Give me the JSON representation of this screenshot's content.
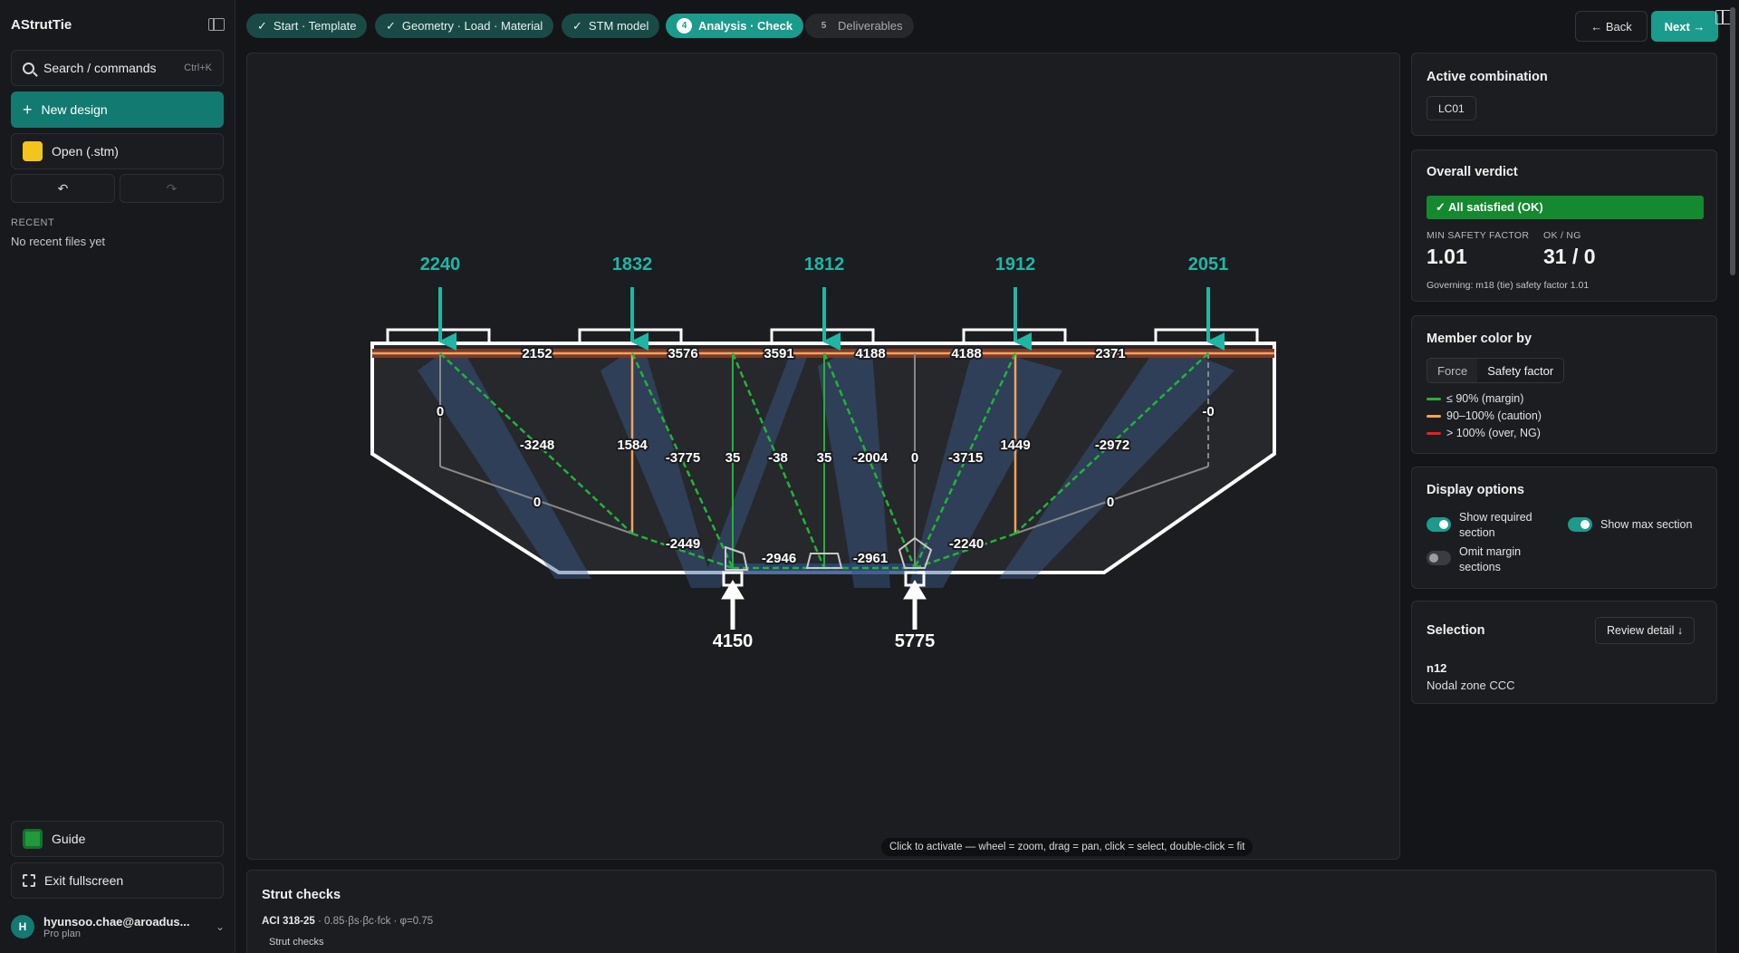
{
  "sidebar": {
    "brand": "AStrutTie",
    "search_label": "Search / commands",
    "search_shortcut": "Ctrl+K",
    "new_design_label": "New design",
    "open_label": "Open (.stm)",
    "recent_label": "RECENT",
    "recent_empty": "No recent files yet",
    "guide_label": "Guide",
    "fullscreen_label": "Exit fullscreen",
    "user_name": "hyunsoo.chae@aroadus...",
    "user_plan": "Pro plan",
    "user_initial": "H"
  },
  "stepper": [
    {
      "label": "Start · Template",
      "mark": "✓",
      "state": "done"
    },
    {
      "label": "Geometry · Load · Material",
      "mark": "✓",
      "state": "done"
    },
    {
      "label": "STM model",
      "mark": "✓",
      "state": "done"
    },
    {
      "label": "Analysis · Check",
      "mark": "4",
      "state": "active"
    },
    {
      "label": "Deliverables",
      "mark": "5",
      "state": "future"
    }
  ],
  "nav": {
    "back_label": "← Back",
    "next_label": "Next →"
  },
  "canvas": {
    "hint": "Click to activate — wheel = zoom, drag = pan, click = select, double-click = fit",
    "loads": [
      "2240",
      "1832",
      "1812",
      "1912",
      "2051"
    ],
    "reactions": [
      "4150",
      "5775"
    ],
    "top_chord_forces": [
      "2152",
      "3576",
      "3591",
      "4188",
      "4188",
      "2371"
    ],
    "member_forces": [
      "0",
      "-3248",
      "1584",
      "-3775",
      "35",
      "-38",
      "35",
      "-2004",
      "0",
      "-3715",
      "1449",
      "-2972",
      "-0"
    ],
    "bottom_forces": [
      "0",
      "-2449",
      "-2946",
      "-2961",
      "-2240",
      "0"
    ]
  },
  "checks": {
    "title": "Strut checks",
    "code": "ACI 318-25",
    "formula": "· 0.85·βs·βc·fck · φ=0.75",
    "tab": "Strut checks"
  },
  "panel": {
    "combo_title": "Active combination",
    "combo_value": "LC01",
    "verdict_title": "Overall verdict",
    "verdict_text": "✓ All satisfied (OK)",
    "min_sf_label": "MIN SAFETY FACTOR",
    "min_sf_value": "1.01",
    "okng_label": "OK / NG",
    "okng_value": "31 / 0",
    "governing": "Governing: m18 (tie) safety factor 1.01",
    "color_title": "Member color by",
    "color_opts": [
      "Force",
      "Safety factor"
    ],
    "legend": [
      {
        "label": "≤ 90% (margin)",
        "color": "#22b33a"
      },
      {
        "label": "90–100% (caution)",
        "color": "#f5a25d"
      },
      {
        "label": "> 100% (over, NG)",
        "color": "#e02424"
      }
    ],
    "display_title": "Display options",
    "opt_required": "Show required section",
    "opt_max": "Show max section",
    "opt_omit": "Omit margin sections",
    "selection_title": "Selection",
    "review_label": "Review detail ↓",
    "sel_id": "n12",
    "sel_desc": "Nodal zone CCC"
  },
  "colors": {
    "accent": "#1a9b8c",
    "ok": "#14892f",
    "tie": "#f5a25d",
    "strut": "#22b33a"
  }
}
